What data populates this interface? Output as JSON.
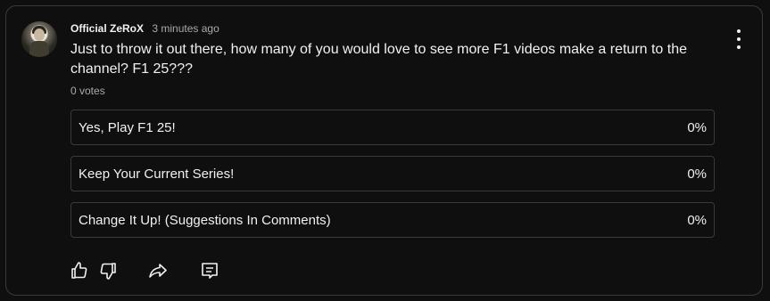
{
  "post": {
    "author": "Official ZeRoX",
    "time": "3 minutes ago",
    "question": "Just to throw it out there, how many of you would love to see more F1 videos make a return to the channel? F1 25???",
    "votes": "0 votes"
  },
  "poll": {
    "options": [
      {
        "label": "Yes, Play F1 25!",
        "percent": "0%"
      },
      {
        "label": "Keep Your Current Series!",
        "percent": "0%"
      },
      {
        "label": "Change It Up! (Suggestions In Comments)",
        "percent": "0%"
      }
    ]
  },
  "icons": {
    "like": "thumbs-up-icon",
    "dislike": "thumbs-down-icon",
    "share": "share-icon",
    "comment": "comment-icon",
    "menu": "more-vertical-icon"
  },
  "colors": {
    "background": "#0f0f0f",
    "border": "#3a3a3a",
    "text": "#f1f1f1",
    "secondary_text": "#aaaaaa"
  }
}
